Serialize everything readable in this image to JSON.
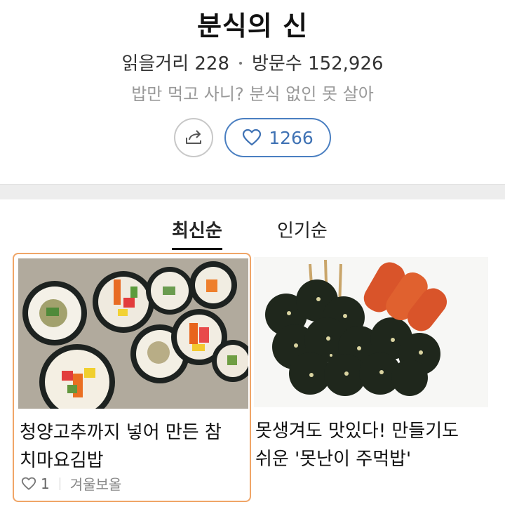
{
  "header": {
    "title": "분식의 신",
    "stats_reads_label": "읽을거리 228",
    "stats_visitors_label": "방문수 152,926",
    "tagline": "밥만 먹고 사니? 분식 없인 못 살아",
    "like_count": "1266",
    "icons": {
      "share": "share-icon",
      "like": "heart-icon"
    },
    "accent_color": "#4a7fc1"
  },
  "tabs": [
    {
      "label": "최신순",
      "active": true
    },
    {
      "label": "인기순",
      "active": false
    }
  ],
  "cards": [
    {
      "title_line1": "청양고추까지 넣어 만든 참",
      "title_line2": "치마요김밥",
      "likes": "1",
      "author": "겨울보올",
      "image": "kimbap-photo",
      "highlight_color": "#f0a567"
    },
    {
      "title_line1": "못생겨도 맛있다! 만들기도",
      "title_line2": "쉬운 '못난이 주먹밥'",
      "image": "rice-ball-photo"
    }
  ]
}
